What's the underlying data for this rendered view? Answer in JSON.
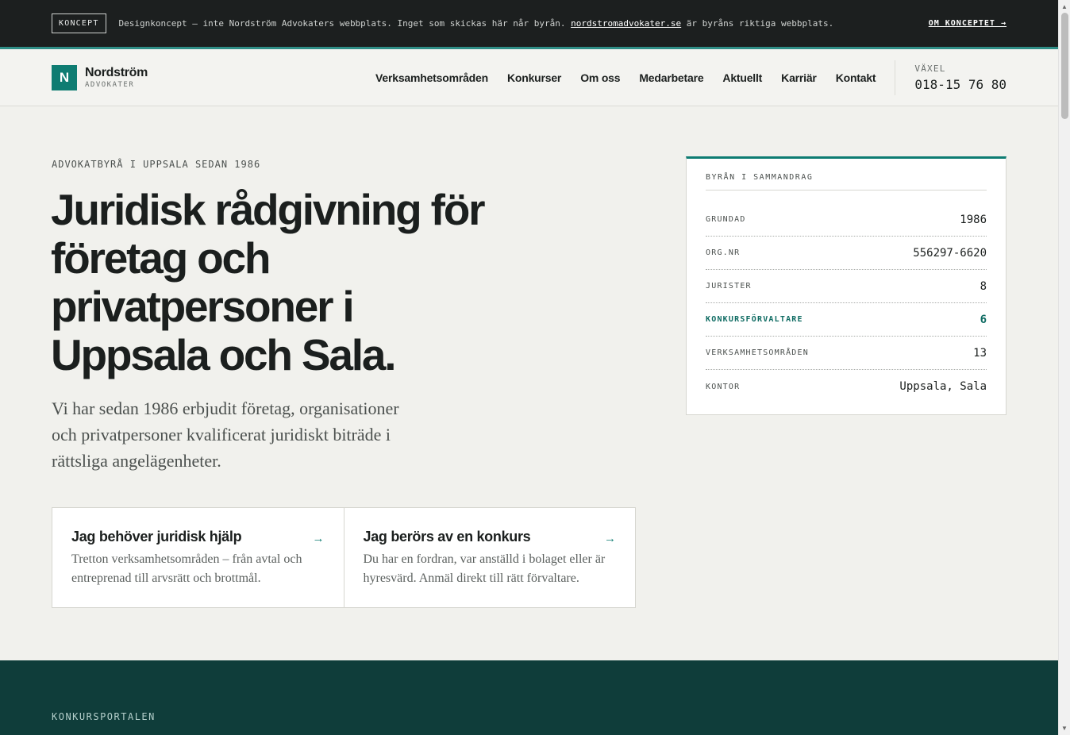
{
  "notice": {
    "tag": "KONCEPT",
    "message_before": "Designkoncept – inte Nordström Advokaters webbplats. Inget som skickas här når byrån. ",
    "link_text": "nordstromadvokater.se",
    "message_after": " är byråns riktiga webbplats.",
    "about": "OM KONCEPTET →"
  },
  "header": {
    "logo_letter": "N",
    "logo_name": "Nordström",
    "logo_sub": "ADVOKATER",
    "nav": [
      "Verksamhetsområden",
      "Konkurser",
      "Om oss",
      "Medarbetare",
      "Aktuellt",
      "Karriär",
      "Kontakt"
    ],
    "phone_label": "VÄXEL",
    "phone_number": "018-15 76 80"
  },
  "hero": {
    "eyebrow": "ADVOKATBYRÅ I UPPSALA SEDAN 1986",
    "headline": "Juridisk rådgivning för företag och privatpersoner i Uppsala och Sala.",
    "lede": "Vi har sedan 1986 erbjudit företag, organisationer och privatpersoner kvalificerat juridiskt biträde i rättsliga angelägenheter."
  },
  "cards": [
    {
      "title": "Jag behöver juridisk hjälp",
      "arrow": "→",
      "text": "Tretton verksamhetsområden – från avtal och entreprenad till arvsrätt och brottmål."
    },
    {
      "title": "Jag berörs av en konkurs",
      "arrow": "→",
      "text": "Du har en fordran, var anställd i bolaget eller är hyresvärd. Anmäl direkt till rätt förvaltare."
    }
  ],
  "summary": {
    "title": "BYRÅN I SAMMANDRAG",
    "rows": [
      {
        "label": "GRUNDAD",
        "value": "1986"
      },
      {
        "label": "ORG.NR",
        "value": "556297-6620"
      },
      {
        "label": "JURISTER",
        "value": "8"
      },
      {
        "label": "KONKURSFÖRVALTARE",
        "value": "6"
      },
      {
        "label": "VERKSAMHETSOMRÅDEN",
        "value": "13"
      },
      {
        "label": "KONTOR",
        "value": "Uppsala, Sala"
      }
    ]
  },
  "section": {
    "label": "KONKURSPORTALEN"
  },
  "colors": {
    "accent": "#0e7c72",
    "dark_section": "#0f3d3a",
    "notice_bar": "#1c1f1f"
  }
}
